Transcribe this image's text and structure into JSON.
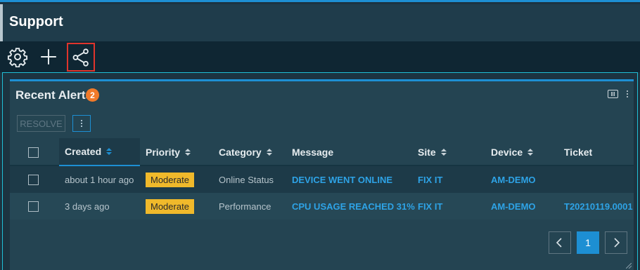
{
  "page": {
    "title": "Support"
  },
  "toolbar": {
    "icons": [
      "gear-icon",
      "plus-icon",
      "share-icon"
    ],
    "selected": "share-icon",
    "highlight_color": "#e0342c"
  },
  "card": {
    "title": "Recent Alerts",
    "badge_count": "2",
    "resolve_label": "RESOLVE",
    "columns": {
      "created": "Created",
      "priority": "Priority",
      "category": "Category",
      "message": "Message",
      "site": "Site",
      "device": "Device",
      "ticket": "Ticket"
    },
    "sorted_column": "Created",
    "sort_direction": "ascending",
    "rows": [
      {
        "created": "about 1 hour ago",
        "priority": "Moderate",
        "category": "Online Status",
        "message": "DEVICE WENT ONLINE",
        "site": "FIX IT",
        "device": "AM-DEMO",
        "ticket": ""
      },
      {
        "created": "3 days ago",
        "priority": "Moderate",
        "category": "Performance",
        "message": "CPU USAGE REACHED 31%",
        "site": "FIX IT",
        "device": "AM-DEMO",
        "ticket": "T20210119.0001"
      }
    ]
  },
  "pagination": {
    "current_page": "1"
  },
  "colors": {
    "accent": "#1d8fd3",
    "badge": "#f07a2a",
    "priority_moderate": "#f0b92b",
    "link": "#2ea3e6"
  }
}
